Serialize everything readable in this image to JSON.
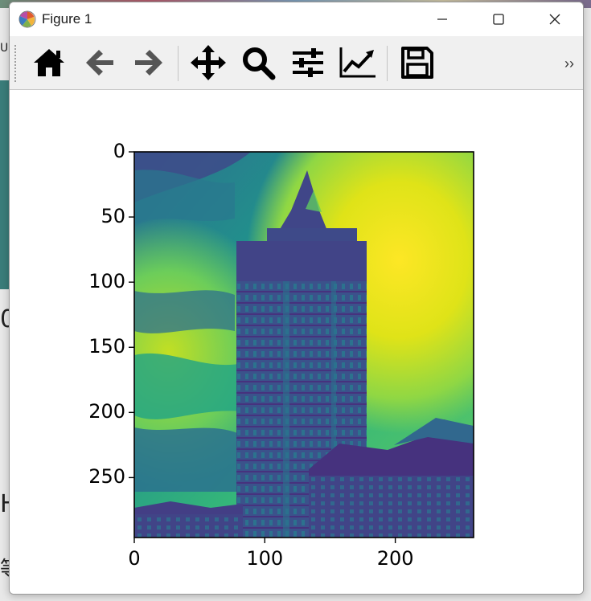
{
  "window": {
    "title": "Figure 1",
    "controls": [
      "minimize",
      "maximize",
      "close"
    ]
  },
  "toolbar": {
    "buttons": [
      {
        "name": "home",
        "icon": "home-icon"
      },
      {
        "name": "back",
        "icon": "arrow-left-icon"
      },
      {
        "name": "forward",
        "icon": "arrow-right-icon"
      },
      {
        "name": "pan",
        "icon": "move-icon"
      },
      {
        "name": "zoom",
        "icon": "magnifier-icon"
      },
      {
        "name": "configure-subplots",
        "icon": "sliders-icon"
      },
      {
        "name": "edit-axes",
        "icon": "line-chart-icon"
      },
      {
        "name": "save",
        "icon": "floppy-disk-icon"
      }
    ],
    "overflow_label": "››"
  },
  "chart_data": {
    "type": "heatmap",
    "colormap": "viridis",
    "image_width": 260,
    "image_height": 296,
    "x_ticks": [
      "0",
      "100",
      "200"
    ],
    "y_ticks": [
      "0",
      "50",
      "100",
      "150",
      "200",
      "250"
    ],
    "xlim": [
      0,
      260
    ],
    "ylim": [
      296,
      0
    ],
    "subject": "tall tower building with traditional pitched-roof buildings against a cloudy sky"
  },
  "desktop": {
    "left_fragments": [
      "0",
      "H",
      "等"
    ],
    "top_fragment": "U"
  }
}
